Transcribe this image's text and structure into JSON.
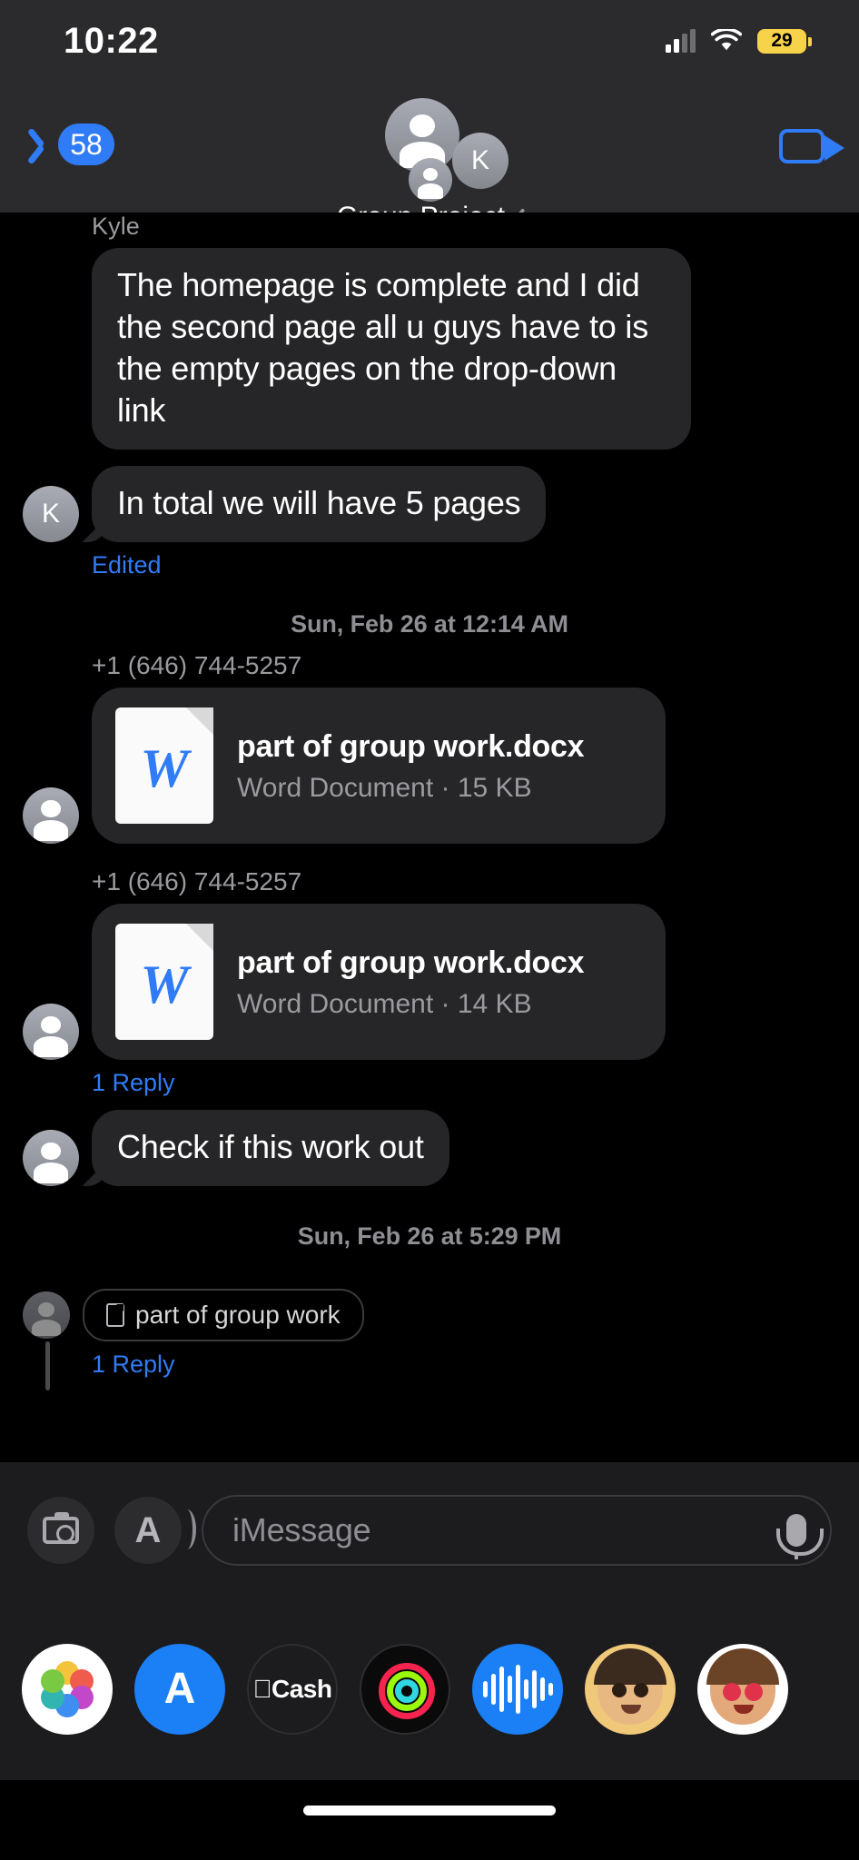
{
  "status_bar": {
    "time": "10:22",
    "battery_percent": "29",
    "cellular_icon": "cellular-bars-icon",
    "wifi_icon": "wifi-icon",
    "battery_color": "#f6d34a"
  },
  "nav_bar": {
    "back_badge": "58",
    "back_icon": "chevron-left-icon",
    "title": "Group Project",
    "title_chevron_icon": "chevron-right-icon",
    "facetime_icon": "video-camera-icon",
    "avatar_initial": "K",
    "accent_color": "#2f7cf6"
  },
  "thread": {
    "messages": [
      {
        "id": "msg-kyle-homepage",
        "sender": "Kyle",
        "text": "The homepage is complete and I did the second page all u guys have to is the empty pages on the drop-down link",
        "type": "text"
      },
      {
        "id": "msg-kyle-total",
        "sender_initial": "K",
        "text": "In total we will have 5 pages",
        "meta": "Edited",
        "type": "text"
      },
      {
        "id": "divider-1",
        "type": "divider",
        "text": "Sun, Feb 26 at 12:14 AM"
      },
      {
        "id": "msg-attach-1",
        "phone": "+1 (646) 744-5257",
        "type": "attachment",
        "file_name": "part of group work.docx",
        "file_meta": "Word Document · 15 KB",
        "file_icon": "word-document-icon",
        "file_glyph": "W"
      },
      {
        "id": "msg-attach-2",
        "phone": "+1 (646) 744-5257",
        "type": "attachment",
        "file_name": "part of group work.docx",
        "file_meta": "Word Document · 14 KB",
        "file_icon": "word-document-icon",
        "file_glyph": "W",
        "meta": "1 Reply"
      },
      {
        "id": "msg-check",
        "type": "text",
        "text": "Check if this work out"
      },
      {
        "id": "divider-2",
        "type": "divider",
        "text": "Sun, Feb 26 at 5:29 PM"
      },
      {
        "id": "msg-reply-preview",
        "type": "reply",
        "text": "part of group work",
        "chip_icon": "document-icon",
        "meta": "1 Reply"
      }
    ]
  },
  "input_bar": {
    "camera_icon": "camera-icon",
    "appstore_icon": "app-store-icon",
    "placeholder": "iMessage",
    "mic_icon": "microphone-icon"
  },
  "app_dock": {
    "apps": [
      {
        "name": "photos-app",
        "label": "Photos"
      },
      {
        "name": "app-store-app",
        "label": "A"
      },
      {
        "name": "apple-cash-app",
        "label": "Cash"
      },
      {
        "name": "fitness-app",
        "label": "Fitness"
      },
      {
        "name": "voice-memos-app",
        "label": "Voice Memos"
      },
      {
        "name": "memoji-app-1",
        "label": "Memoji"
      },
      {
        "name": "memoji-app-2",
        "label": "Memoji Stickers"
      }
    ]
  },
  "home_indicator": {
    "name": "home-indicator"
  }
}
